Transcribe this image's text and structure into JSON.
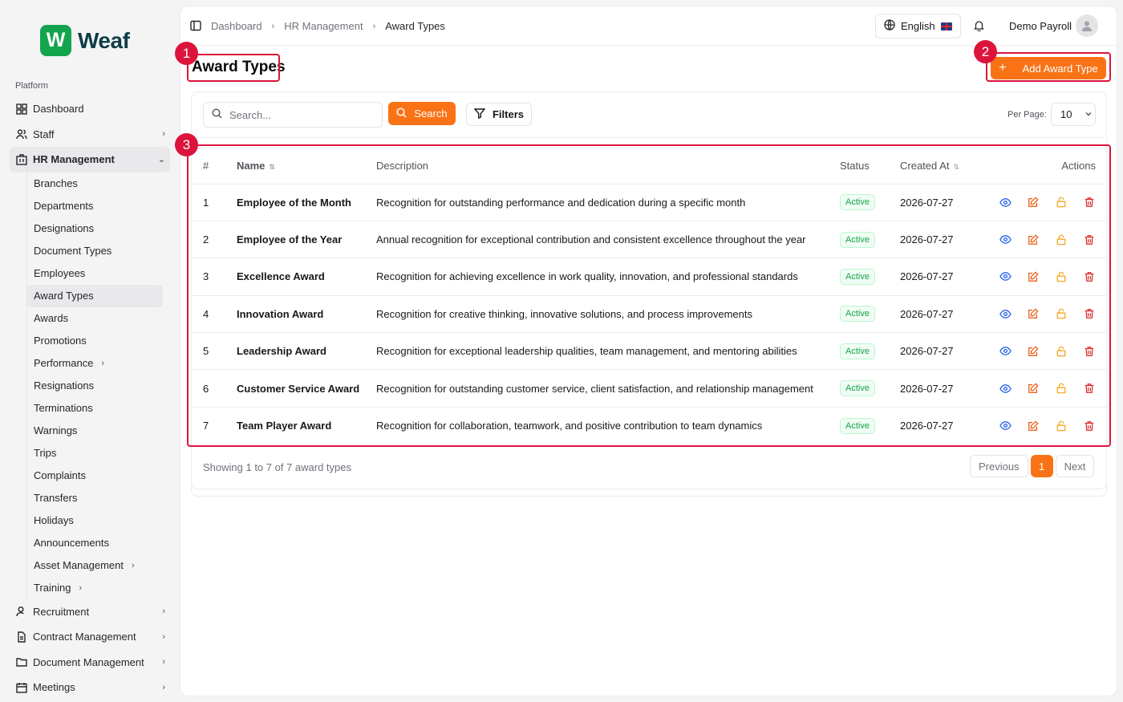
{
  "app": {
    "logo_letter": "W",
    "logo_text": "Weaf"
  },
  "sidebar": {
    "section_label": "Platform",
    "items_top": [
      {
        "label": "Dashboard",
        "icon": "grid-icon"
      },
      {
        "label": "Staff",
        "icon": "users-icon"
      }
    ],
    "hr": {
      "label": "HR Management",
      "icon": "building-icon"
    },
    "hr_sub": [
      "Branches",
      "Departments",
      "Designations",
      "Document Types",
      "Employees",
      "Award Types",
      "Awards",
      "Promotions",
      "Performance",
      "Resignations",
      "Terminations",
      "Warnings",
      "Trips",
      "Complaints",
      "Transfers",
      "Holidays",
      "Announcements",
      "Asset Management",
      "Training"
    ],
    "items_bottom": [
      {
        "label": "Recruitment",
        "icon": "user-search-icon"
      },
      {
        "label": "Contract Management",
        "icon": "file-icon"
      },
      {
        "label": "Document Management",
        "icon": "folder-icon"
      },
      {
        "label": "Meetings",
        "icon": "calendar-icon"
      }
    ]
  },
  "topbar": {
    "breadcrumb": [
      "Dashboard",
      "HR Management",
      "Award Types"
    ],
    "language": "English",
    "user_name": "Demo Payroll"
  },
  "page": {
    "title": "Award Types",
    "add_button": "Add Award Type"
  },
  "filters": {
    "search_placeholder": "Search...",
    "search_button": "Search",
    "filters_button": "Filters",
    "per_page_label": "Per Page:",
    "per_page_value": "10"
  },
  "table": {
    "headers": {
      "num": "#",
      "name": "Name",
      "description": "Description",
      "status": "Status",
      "created_at": "Created At",
      "actions": "Actions"
    },
    "rows": [
      {
        "num": "1",
        "name": "Employee of the Month",
        "description": "Recognition for outstanding performance and dedication during a specific month",
        "status": "Active",
        "created_at": "2026-07-27"
      },
      {
        "num": "2",
        "name": "Employee of the Year",
        "description": "Annual recognition for exceptional contribution and consistent excellence throughout the year",
        "status": "Active",
        "created_at": "2026-07-27"
      },
      {
        "num": "3",
        "name": "Excellence Award",
        "description": "Recognition for achieving excellence in work quality, innovation, and professional standards",
        "status": "Active",
        "created_at": "2026-07-27"
      },
      {
        "num": "4",
        "name": "Innovation Award",
        "description": "Recognition for creative thinking, innovative solutions, and process improvements",
        "status": "Active",
        "created_at": "2026-07-27"
      },
      {
        "num": "5",
        "name": "Leadership Award",
        "description": "Recognition for exceptional leadership qualities, team management, and mentoring abilities",
        "status": "Active",
        "created_at": "2026-07-27"
      },
      {
        "num": "6",
        "name": "Customer Service Award",
        "description": "Recognition for outstanding customer service, client satisfaction, and relationship management",
        "status": "Active",
        "created_at": "2026-07-27"
      },
      {
        "num": "7",
        "name": "Team Player Award",
        "description": "Recognition for collaboration, teamwork, and positive contribution to team dynamics",
        "status": "Active",
        "created_at": "2026-07-27"
      }
    ]
  },
  "pagination": {
    "summary": "Showing 1 to 7 of 7 award types",
    "previous": "Previous",
    "current": "1",
    "next": "Next"
  },
  "annotations": [
    "1",
    "2",
    "3"
  ],
  "colors": {
    "accent": "#f97316",
    "annotation": "#dc143c",
    "status_active": "#16a34a",
    "view_icon": "#2563eb",
    "edit_icon": "#ea580c",
    "lock_icon": "#f59e0b",
    "delete_icon": "#dc2626"
  }
}
